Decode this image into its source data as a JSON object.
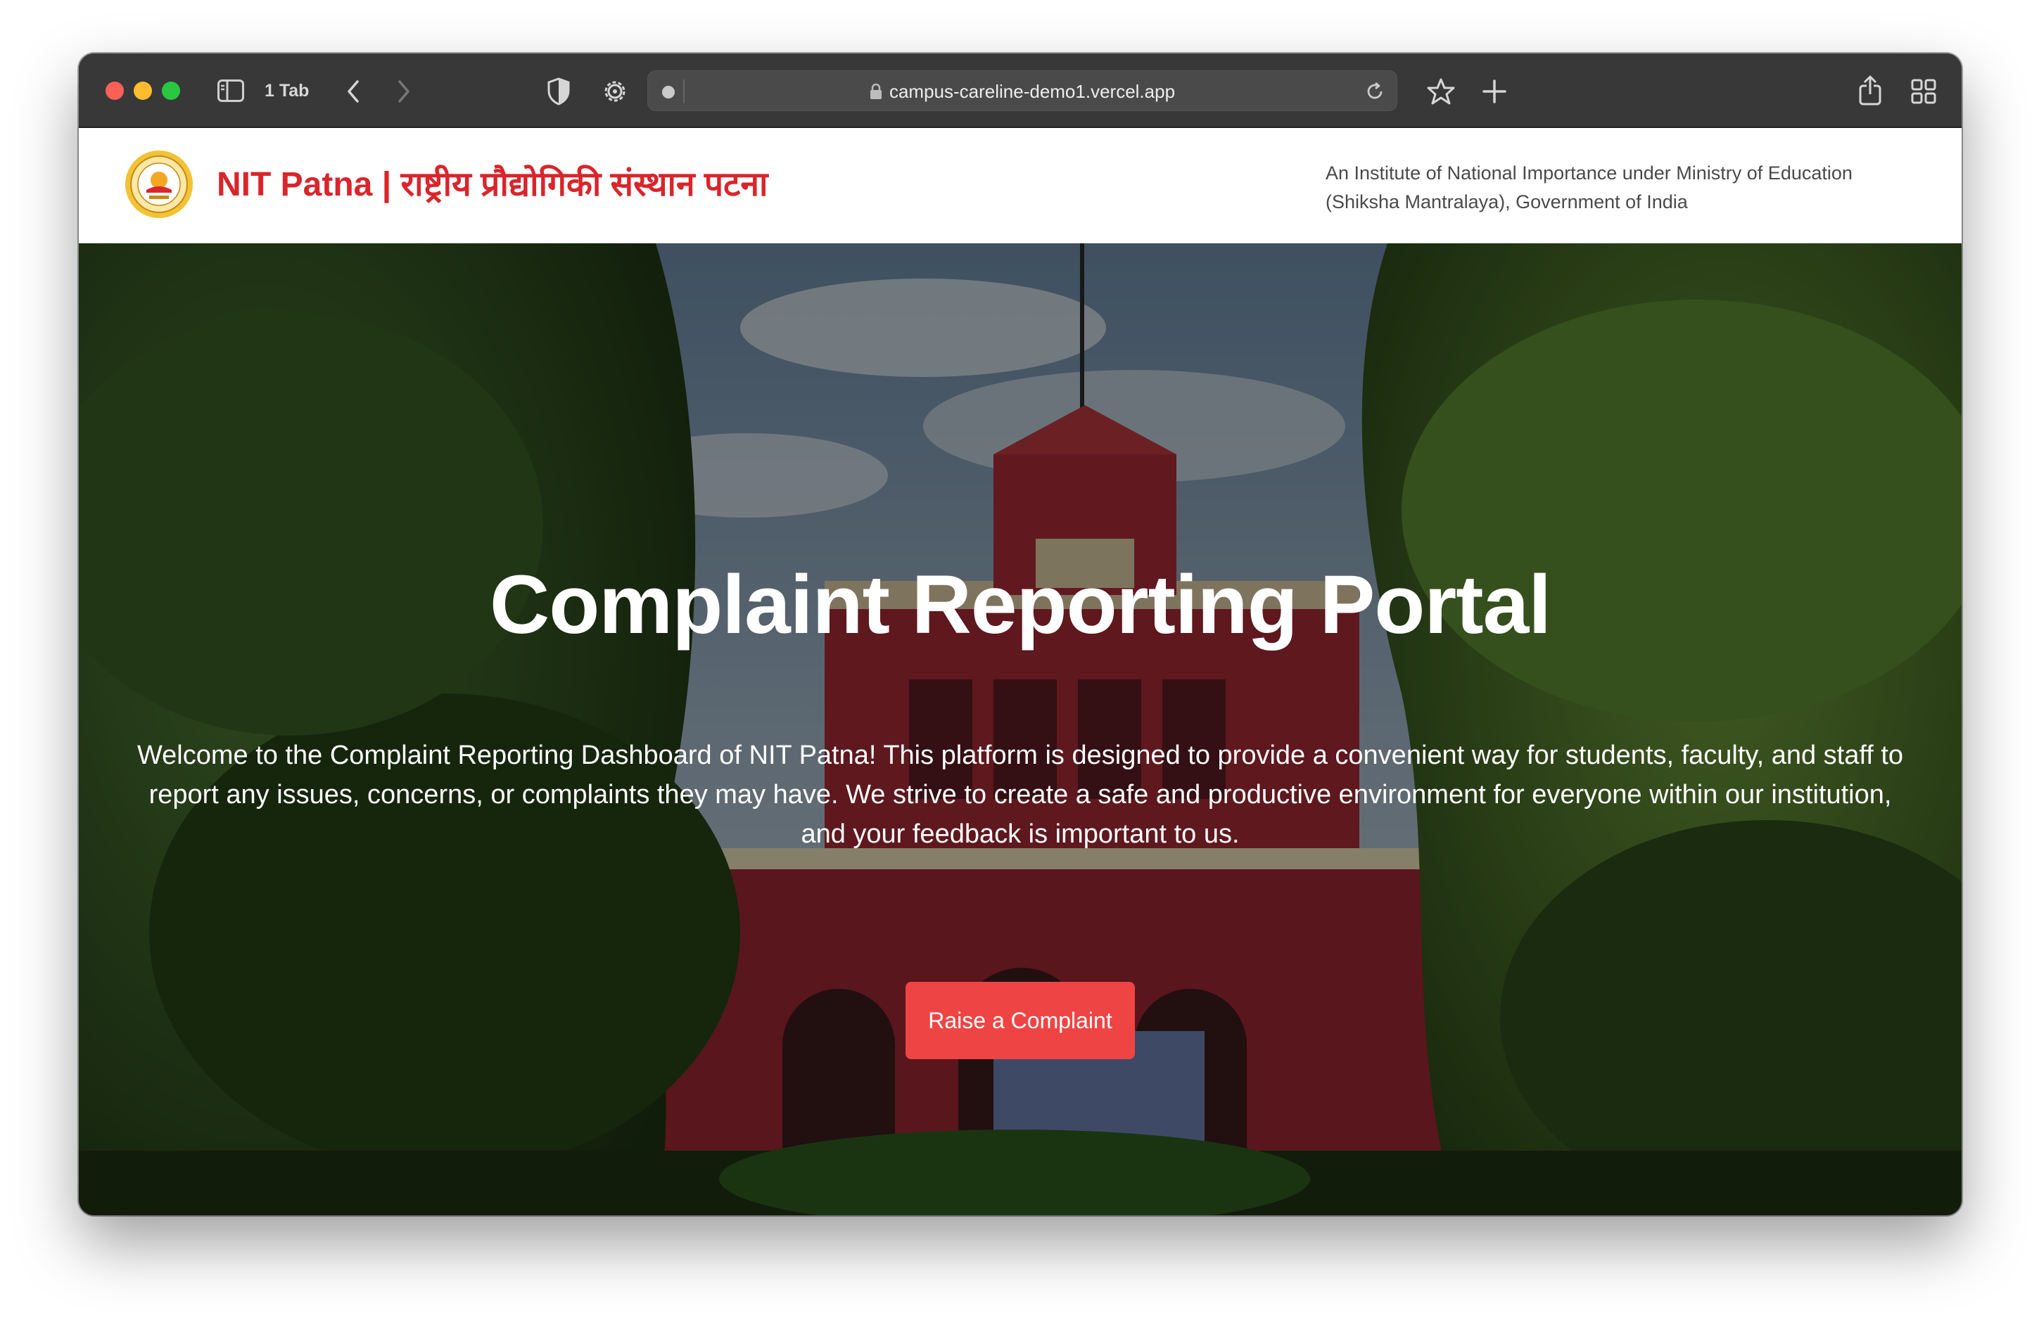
{
  "browser": {
    "tab_count_label": "1 Tab",
    "url": "campus-careline-demo1.vercel.app",
    "icons": [
      "sidebar-icon",
      "chevron-left-icon",
      "chevron-right-icon",
      "shield-icon",
      "gear-icon",
      "lock-icon",
      "reload-icon",
      "star-icon",
      "plus-icon",
      "share-icon",
      "tab-overview-icon"
    ]
  },
  "header": {
    "title": "NIT Patna | राष्ट्रीय प्रौद्योगिकी संस्थान पटना",
    "tagline_line1": "An Institute of National Importance under Ministry of Education",
    "tagline_line2": "(Shiksha Mantralaya), Government of India",
    "title_color": "#d9252b"
  },
  "hero": {
    "title": "Complaint Reporting Portal",
    "description": "Welcome to the Complaint Reporting Dashboard of NIT Patna! This platform is designed to provide a convenient way for students, faculty, and staff to report any issues, concerns, or complaints they may have. We strive to create a safe and productive environment for everyone within our institution, and your feedback is important to us.",
    "cta_label": "Raise a Complaint",
    "cta_color": "#ef4444"
  }
}
